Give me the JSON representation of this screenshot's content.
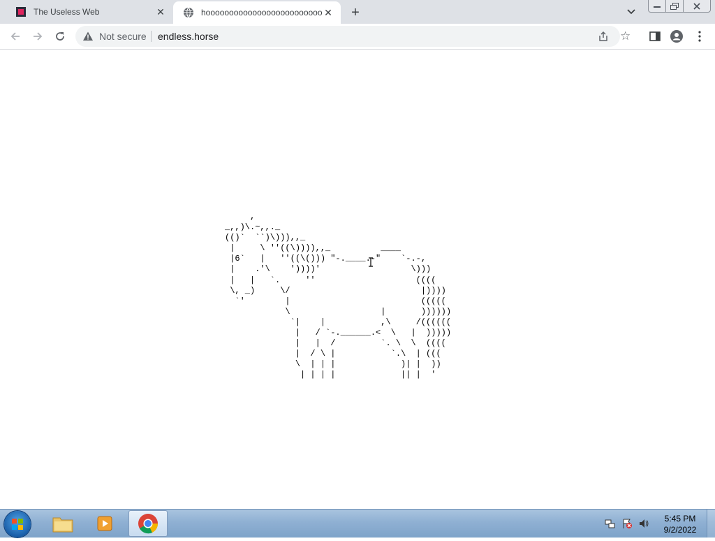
{
  "browser": {
    "tabs": [
      {
        "title": "The Useless Web",
        "favicon": "useless-web-favicon",
        "active": false
      },
      {
        "title": "hoooooooooooooooooooooooooooooooooo",
        "favicon": "globe-icon",
        "active": true
      }
    ],
    "new_tab_label": "+",
    "address": {
      "security_text": "Not secure",
      "url": "endless.horse"
    }
  },
  "page": {
    "ascii_art": "     ,\n_,,)\\.~,,._\n(()`  ``)\\))),,_\n |     \\ ''((\\)))),,_          ____\n |6`   |   ''((\\())) \"-.____.-\"    `-.-,\n |    .'\\    '))))'                  \\)))\n |   |   `.     ''                    ((((\n \\, _)     \\/                          |))))\n  `'        |                          (((((\n            \\                  |       ))))))\n             `|    |           ,\\     /((((((\n              |   / `-.______.<  \\   |  )))))\n              |   |  /         `. \\  \\  ((((\n              |  / \\ |           `.\\  | (((\n              \\  | | |             )| |  ))\n               | | | |             || |  '"
  },
  "taskbar": {
    "pinned": [
      "folder-icon",
      "media-player-icon",
      "chrome-icon"
    ],
    "clock_time": "5:45 PM",
    "clock_date": "9/2/2022"
  },
  "colors": {
    "tabstrip": "#dee1e6",
    "omnibox": "#f1f3f4",
    "taskbar": "#8fb0d3",
    "useless_web_brand": "#e0245e"
  }
}
